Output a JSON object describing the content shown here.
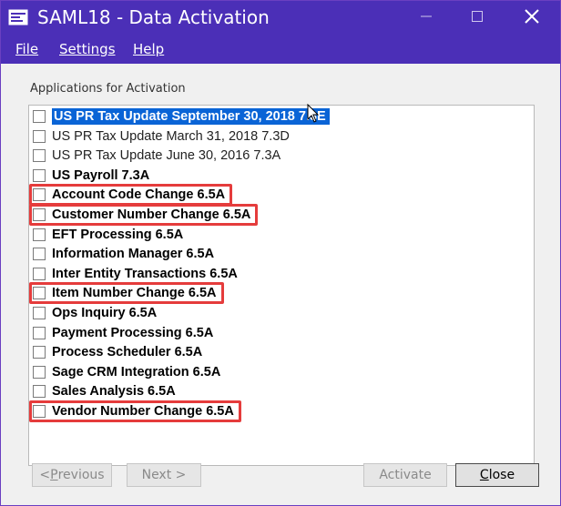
{
  "window": {
    "title": "SAML18 - Data Activation",
    "minimize_glyph": "—",
    "maximize_glyph": "☐",
    "close_glyph": "✕"
  },
  "menu": {
    "file": "File",
    "settings": "Settings",
    "help": "Help"
  },
  "group_label": "Applications for Activation",
  "items": [
    {
      "label": "US PR Tax Update September 30, 2018 7.3E",
      "style": "selected",
      "highlighted": false
    },
    {
      "label": "US PR Tax Update March 31, 2018 7.3D",
      "style": "light",
      "highlighted": false
    },
    {
      "label": "US PR Tax Update June 30, 2016 7.3A",
      "style": "light",
      "highlighted": false
    },
    {
      "label": "US Payroll 7.3A",
      "style": "bold",
      "highlighted": false
    },
    {
      "label": "Account Code Change 6.5A",
      "style": "bold",
      "highlighted": true
    },
    {
      "label": "Customer Number Change 6.5A",
      "style": "bold",
      "highlighted": true
    },
    {
      "label": "EFT Processing 6.5A",
      "style": "bold",
      "highlighted": false
    },
    {
      "label": "Information Manager 6.5A",
      "style": "bold",
      "highlighted": false
    },
    {
      "label": "Inter Entity Transactions 6.5A",
      "style": "bold",
      "highlighted": false
    },
    {
      "label": "Item Number Change 6.5A",
      "style": "bold",
      "highlighted": true
    },
    {
      "label": "Ops Inquiry 6.5A",
      "style": "bold",
      "highlighted": false
    },
    {
      "label": "Payment Processing 6.5A",
      "style": "bold",
      "highlighted": false
    },
    {
      "label": "Process Scheduler 6.5A",
      "style": "bold",
      "highlighted": false
    },
    {
      "label": "Sage CRM Integration 6.5A",
      "style": "bold",
      "highlighted": false
    },
    {
      "label": "Sales Analysis 6.5A",
      "style": "bold",
      "highlighted": false
    },
    {
      "label": "Vendor Number Change 6.5A",
      "style": "bold",
      "highlighted": true
    }
  ],
  "buttons": {
    "previous": {
      "mnemonic": "P",
      "rest": "revious",
      "prefix": "< ",
      "enabled": false
    },
    "next": {
      "label": "Next >",
      "enabled": false
    },
    "activate": {
      "label": "Activate",
      "enabled": false
    },
    "close": {
      "mnemonic": "C",
      "rest": "lose",
      "enabled": true
    }
  },
  "colors": {
    "titlebar": "#4b2fb7",
    "selection": "#0a64d6",
    "highlight_box": "#e53c3c"
  }
}
